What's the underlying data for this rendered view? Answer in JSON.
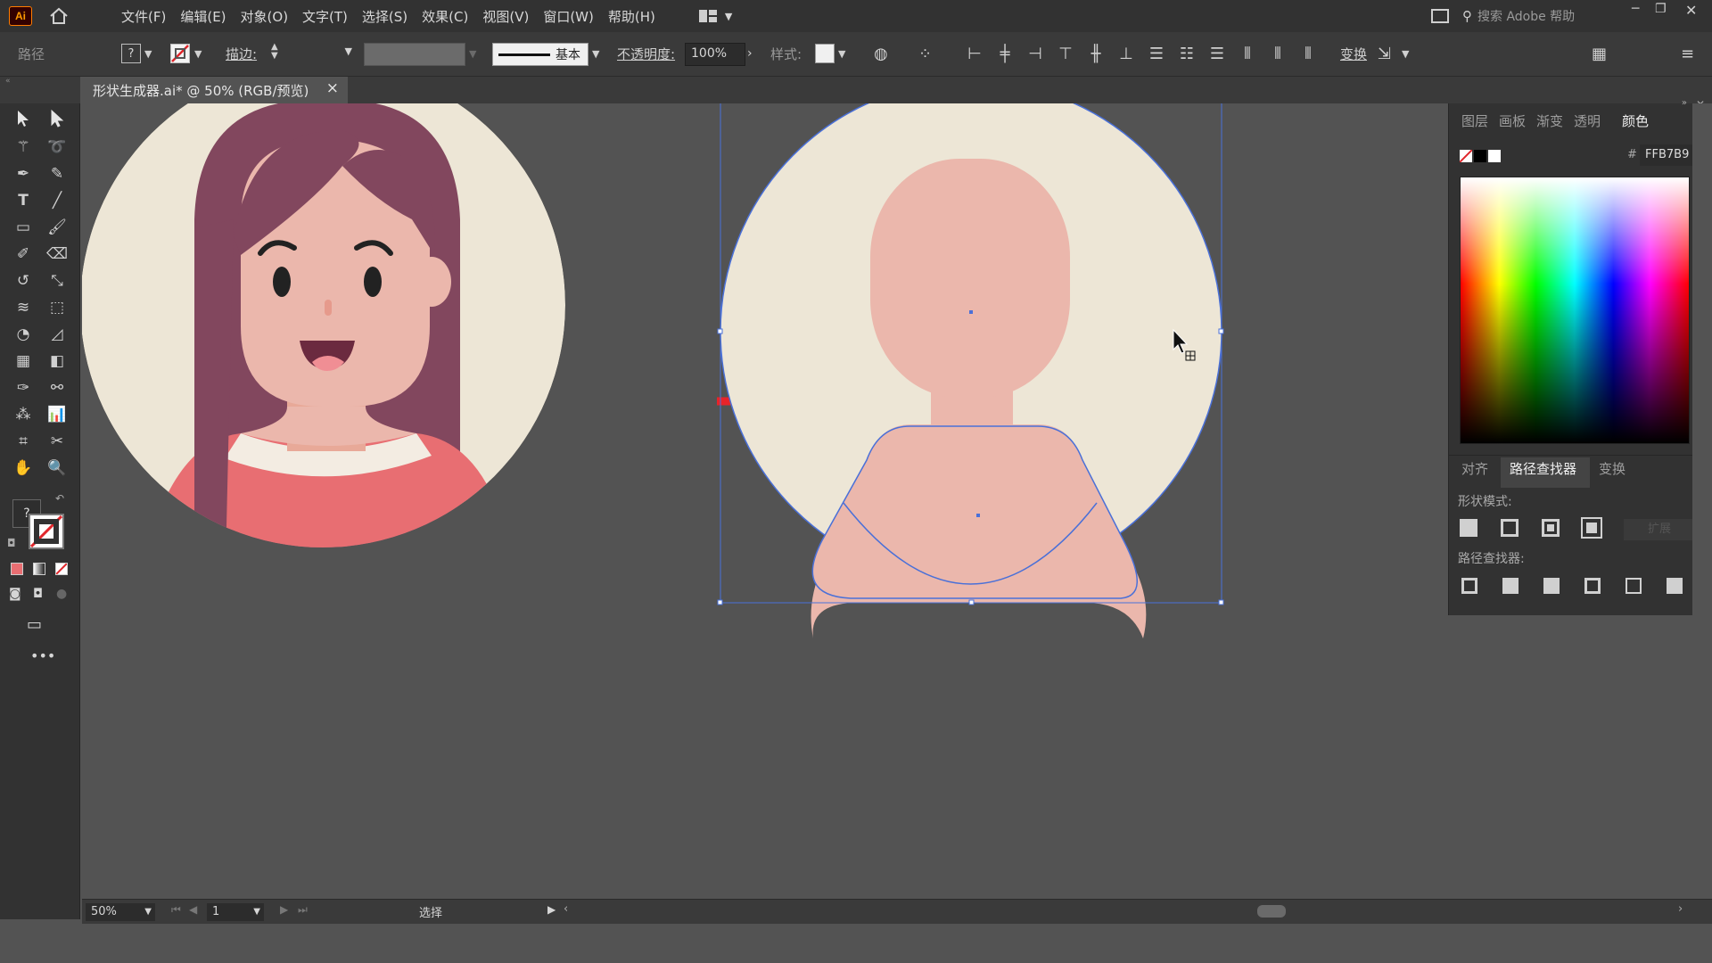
{
  "app": {
    "logo": "Ai"
  },
  "menu": [
    "文件(F)",
    "编辑(E)",
    "对象(O)",
    "文字(T)",
    "选择(S)",
    "效果(C)",
    "视图(V)",
    "窗口(W)",
    "帮助(H)"
  ],
  "search": {
    "placeholder": "搜索 Adobe 帮助"
  },
  "control_bar": {
    "object_type": "路径",
    "stroke_label": "描边:",
    "stroke_profile": "基本",
    "opacity_label": "不透明度:",
    "opacity_value": "100%",
    "style_label": "样式:",
    "transform_label": "变换"
  },
  "document_tab": {
    "title": "形状生成器.ai* @ 50% (RGB/预览)",
    "close": "×"
  },
  "tools": {
    "unknown_fill": "?"
  },
  "right_panel": {
    "top_tabs": [
      "图层",
      "画板",
      "渐变",
      "透明",
      "颜色"
    ],
    "hex_prefix": "#",
    "hex_value": "FFB7B9",
    "bottom_tabs": [
      "对齐",
      "路径查找器",
      "变换"
    ],
    "shape_modes_label": "形状模式:",
    "expand_label": "扩展",
    "pathfinders_label": "路径查找器:"
  },
  "status_bar": {
    "zoom": "50%",
    "artboard": "1",
    "tool": "选择"
  },
  "colors": {
    "bg_circle": "#EDE6D6",
    "skin": "#EBB7AC",
    "hair": "#82475E",
    "shirt": "#E86E72",
    "arrow": "#E8242A",
    "selection": "#4A70D8"
  }
}
